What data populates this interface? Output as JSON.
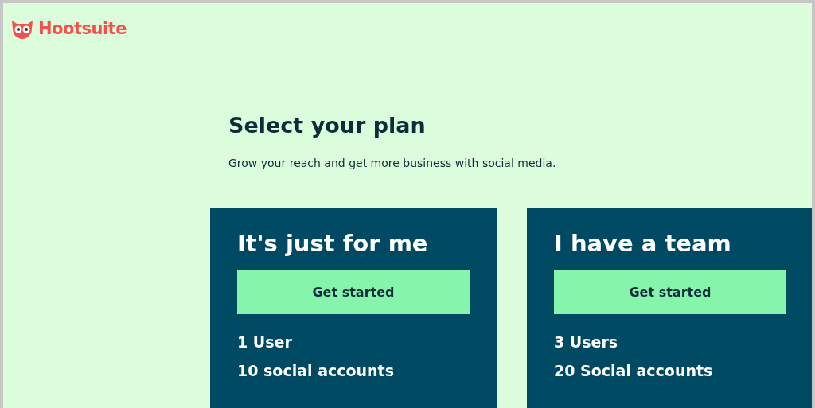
{
  "logo": {
    "text": "Hootsuite"
  },
  "heading": "Select your plan",
  "subtitle": "Grow your reach and get more business with social media.",
  "plans": [
    {
      "title": "It's just for me",
      "button": "Get started",
      "features": [
        "1 User",
        "10 social accounts"
      ]
    },
    {
      "title": "I have a team",
      "button": "Get started",
      "features": [
        "3 Users",
        "20 Social accounts"
      ]
    }
  ]
}
